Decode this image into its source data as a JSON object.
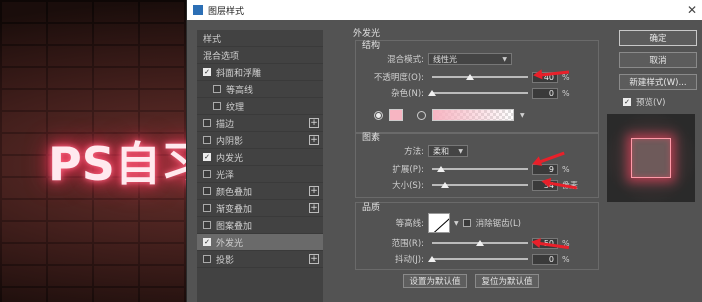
{
  "canvas": {
    "neon_text": "PS自习"
  },
  "dialog": {
    "title": "图层样式",
    "close_glyph": "✕"
  },
  "style_list": {
    "header": "样式",
    "items": [
      {
        "label": "混合选项",
        "checkbox": null,
        "plus": false,
        "indent": false,
        "selected": false
      },
      {
        "label": "斜面和浮雕",
        "checkbox": true,
        "plus": false,
        "indent": false,
        "selected": false
      },
      {
        "label": "等高线",
        "checkbox": false,
        "plus": false,
        "indent": true,
        "selected": false
      },
      {
        "label": "纹理",
        "checkbox": false,
        "plus": false,
        "indent": true,
        "selected": false
      },
      {
        "label": "描边",
        "checkbox": false,
        "plus": true,
        "indent": false,
        "selected": false
      },
      {
        "label": "内阴影",
        "checkbox": false,
        "plus": true,
        "indent": false,
        "selected": false
      },
      {
        "label": "内发光",
        "checkbox": true,
        "plus": false,
        "indent": false,
        "selected": false
      },
      {
        "label": "光泽",
        "checkbox": false,
        "plus": false,
        "indent": false,
        "selected": false
      },
      {
        "label": "颜色叠加",
        "checkbox": false,
        "plus": true,
        "indent": false,
        "selected": false
      },
      {
        "label": "渐变叠加",
        "checkbox": false,
        "plus": true,
        "indent": false,
        "selected": false
      },
      {
        "label": "图案叠加",
        "checkbox": false,
        "plus": false,
        "indent": false,
        "selected": false
      },
      {
        "label": "外发光",
        "checkbox": true,
        "plus": false,
        "indent": false,
        "selected": true
      },
      {
        "label": "投影",
        "checkbox": false,
        "plus": true,
        "indent": false,
        "selected": false
      }
    ]
  },
  "outer_glow": {
    "title": "外发光",
    "structure": {
      "title": "结构",
      "blend_mode_label": "混合模式:",
      "blend_mode_value": "线性光",
      "opacity_label": "不透明度(O):",
      "opacity_value": "40",
      "opacity_level": 0.4,
      "noise_label": "杂色(N):",
      "noise_value": "0",
      "noise_level": 0.0,
      "percent": "%"
    },
    "elements": {
      "title": "图素",
      "method_label": "方法:",
      "method_value": "柔和",
      "spread_label": "扩展(P):",
      "spread_value": "9",
      "spread_level": 0.09,
      "size_label": "大小(S):",
      "size_value": "34",
      "size_level": 0.14,
      "size_unit": "像素",
      "percent": "%"
    },
    "quality": {
      "title": "品质",
      "contour_label": "等高线:",
      "antialias_label": "消除锯齿(L)",
      "range_label": "范围(R):",
      "range_value": "50",
      "range_level": 0.5,
      "jitter_label": "抖动(J):",
      "jitter_value": "0",
      "jitter_level": 0.0,
      "percent": "%"
    },
    "set_default": "设置为默认值",
    "reset_default": "复位为默认值"
  },
  "actions": {
    "ok": "确定",
    "cancel": "取消",
    "new_style": "新建样式(W)...",
    "preview_label": "预览(V)"
  },
  "colors": {
    "glow": "#f7b5c2",
    "annotation_arrow": "#e8202a"
  }
}
